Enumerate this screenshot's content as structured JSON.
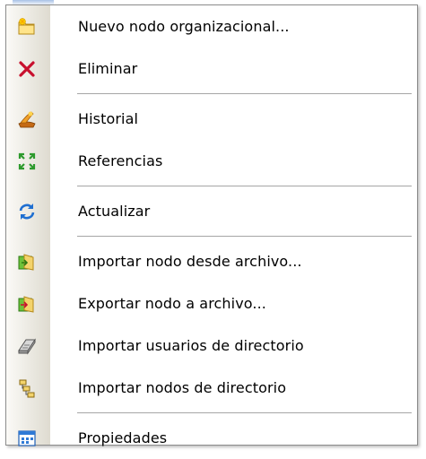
{
  "menu": {
    "items": [
      {
        "label": "Nuevo nodo organizacional...",
        "icon": "new-folder-icon"
      },
      {
        "label": "Eliminar",
        "icon": "delete-icon"
      },
      {
        "label": "Historial",
        "icon": "history-icon"
      },
      {
        "label": "Referencias",
        "icon": "references-icon"
      },
      {
        "label": "Actualizar",
        "icon": "refresh-icon"
      },
      {
        "label": "Importar nodo desde archivo...",
        "icon": "import-node-icon"
      },
      {
        "label": "Exportar nodo a archivo...",
        "icon": "export-node-icon"
      },
      {
        "label": "Importar usuarios de directorio",
        "icon": "import-users-icon"
      },
      {
        "label": "Importar nodos de directorio",
        "icon": "import-nodes-icon"
      },
      {
        "label": "Propiedades",
        "icon": "properties-icon"
      }
    ]
  },
  "colors": {
    "border": "#8c8c8c",
    "separator": "#a6a6a6",
    "gutter_light": "#fbfaf7",
    "gutter_dark": "#dedbd0"
  }
}
